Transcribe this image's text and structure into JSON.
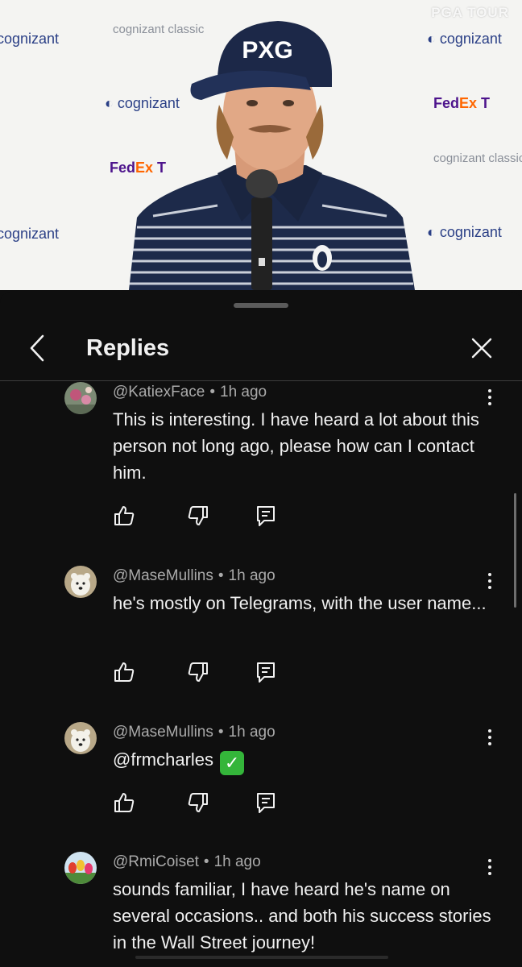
{
  "video": {
    "watermark": "PGA TOUR",
    "backdrop": {
      "cognizant": "cognizant",
      "fedex_fed": "Fed",
      "fedex_ex": "Ex",
      "classic": "cognizant classic"
    },
    "cap_logo": "PXG"
  },
  "sheet": {
    "title": "Replies"
  },
  "comments": [
    {
      "author": "@KatiexFace",
      "time": "1h ago",
      "text": "This is interesting. I have heard a lot about this person not long ago, please how can I contact him.",
      "avatar": "floral-photo"
    },
    {
      "author": "@MaseMullins",
      "time": "1h ago",
      "text": "he's mostly on Telegrams, with the user name...",
      "avatar": "polar-bear-photo"
    },
    {
      "author": "@MaseMullins",
      "time": "1h ago",
      "text": "@frmcharles",
      "emoji": "✓",
      "avatar": "polar-bear-photo"
    },
    {
      "author": "@RmiCoiset",
      "time": "1h ago",
      "text": "sounds familiar, I have heard he's name on several occasions.. and both his success stories in the Wall Street journey!",
      "avatar": "tulips-photo"
    }
  ],
  "icons": {
    "back": "chevron-left-icon",
    "close": "close-icon",
    "like": "thumb-up-icon",
    "dislike": "thumb-down-icon",
    "reply": "reply-comment-icon",
    "more": "more-vertical-icon"
  },
  "colors": {
    "background": "#0f0f0f",
    "text": "#f1f1f1",
    "secondary_text": "#aaaaaa",
    "check_green": "#34b53a"
  }
}
